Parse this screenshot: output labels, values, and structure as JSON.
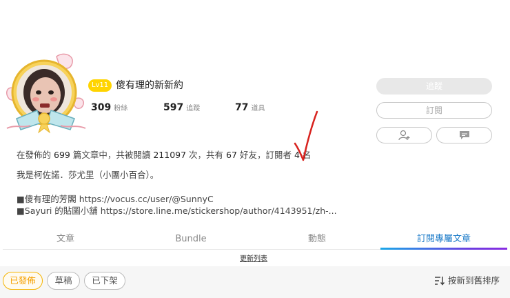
{
  "profile": {
    "level": "Lv11",
    "name": "傻有理的新新約",
    "stats": [
      {
        "value": "309",
        "label": "粉絲"
      },
      {
        "value": "597",
        "label": "追蹤"
      },
      {
        "value": "77",
        "label": "道具"
      }
    ]
  },
  "summary": {
    "prefix": "在發佈的",
    "articles": "699",
    "part1": "篇文章中，共被閱讀",
    "reads": "211097",
    "part2": "次，共有",
    "friends": "67",
    "part3": "好友，訂閱者",
    "subscribers": "4",
    "part4": "名"
  },
  "bio": "我是柯佐諾．莎尤里（小團小百合）。",
  "links": [
    "■傻有理的芳閣 https://vocus.cc/user/@SunnyC",
    "■Sayuri 的貼圖小舖 https://store.line.me/stickershop/author/4143951/zh-..."
  ],
  "actions": {
    "follow": "追蹤",
    "subscribe": "訂閱"
  },
  "tabs": [
    {
      "label": "文章"
    },
    {
      "label": "Bundle"
    },
    {
      "label": "動態"
    },
    {
      "label": "訂閱專屬文章"
    }
  ],
  "update_list": "更新列表",
  "filters": {
    "published": "已發佈",
    "drafts": "草稿",
    "unlisted": "已下架"
  },
  "sort": {
    "label": "按新到舊排序",
    "icon": "sort-desc-icon"
  },
  "colors": {
    "level_badge": "#ffd400",
    "active_tab": "#1a7ac8",
    "active_filter": "#f5a000",
    "checkmark": "#d8231f"
  }
}
